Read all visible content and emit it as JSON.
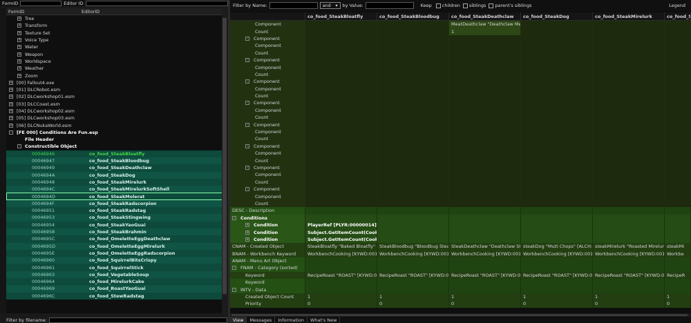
{
  "left": {
    "filter_formid_label": "FormID",
    "filter_editorid_label": "Editor ID",
    "col_formid": "FormID",
    "col_editorid": "EditorID",
    "tree_items": [
      {
        "icon": "+",
        "label": "Tree",
        "level": 2
      },
      {
        "icon": "+",
        "label": "Transform",
        "level": 2
      },
      {
        "icon": "+",
        "label": "Texture Set",
        "level": 2
      },
      {
        "icon": "+",
        "label": "Voice Type",
        "level": 2
      },
      {
        "icon": "+",
        "label": "Water",
        "level": 2
      },
      {
        "icon": "+",
        "label": "Weapon",
        "level": 2
      },
      {
        "icon": "+",
        "label": "Worldspace",
        "level": 2
      },
      {
        "icon": "+",
        "label": "Weather",
        "level": 2
      },
      {
        "icon": "+",
        "label": "Zoom",
        "level": 2
      },
      {
        "icon": "+",
        "label": "[00] Fallout4.exe",
        "level": 1
      },
      {
        "icon": "+",
        "label": "[01] DLCRobot.esm",
        "level": 1
      },
      {
        "icon": "+",
        "label": "[02] DLCworkshop01.esm",
        "level": 1
      },
      {
        "icon": "+",
        "label": "[03] DLCCoast.esm",
        "level": 1
      },
      {
        "icon": "+",
        "label": "[04] DLCworkshop02.esm",
        "level": 1
      },
      {
        "icon": "+",
        "label": "[05] DLCworkshop03.esm",
        "level": 1
      },
      {
        "icon": "+",
        "label": "[06] DLCNukaWorld.esm",
        "level": 1
      },
      {
        "icon": "-",
        "label": "[FE 000] Conditions Are Fun.esp",
        "level": 1,
        "bold": true
      },
      {
        "icon": "",
        "label": "File Header",
        "level": 2,
        "bold": true
      },
      {
        "icon": "-",
        "label": "Constructible Object",
        "level": 2,
        "bold": true
      }
    ],
    "records": [
      {
        "fid": "00046946",
        "eid": "co_food_SteakBloatfly",
        "selected": true
      },
      {
        "fid": "00046947",
        "eid": "co_food_SteakBloodbug"
      },
      {
        "fid": "00046949",
        "eid": "co_food_SteakDeathclaw"
      },
      {
        "fid": "0004694A",
        "eid": "co_food_SteakDog"
      },
      {
        "fid": "00046948",
        "eid": "co_food_SteakMirelurk"
      },
      {
        "fid": "0004694C",
        "eid": "co_food_SteakMirelurkSoftShell"
      },
      {
        "fid": "0004694D",
        "eid": "co_food_SteakMolerat",
        "outlined": true
      },
      {
        "fid": "0004694F",
        "eid": "co_food_SteakRadscorpion"
      },
      {
        "fid": "00046951",
        "eid": "co_food_SteakRadstag"
      },
      {
        "fid": "00046953",
        "eid": "co_food_SteakStingwing"
      },
      {
        "fid": "00046954",
        "eid": "co_food_SteakYaoGuai"
      },
      {
        "fid": "00046958",
        "eid": "co_food_SteakBrahmin"
      },
      {
        "fid": "0004695C",
        "eid": "co_food_OmeletteEggDeathclaw"
      },
      {
        "fid": "0004695D",
        "eid": "co_food_OmeletteEggMirelurk"
      },
      {
        "fid": "0004695E",
        "eid": "co_food_OmeletteEggRadscorpion"
      },
      {
        "fid": "00046960",
        "eid": "co_food_SquirrelBitsCrispy"
      },
      {
        "fid": "00046961",
        "eid": "co_food_SquirrelStick"
      },
      {
        "fid": "00046963",
        "eid": "co_food_VegetableSoup"
      },
      {
        "fid": "00046964",
        "eid": "co_food_MirelurkCake"
      },
      {
        "fid": "00046969",
        "eid": "co_food_RoastYaoGuai"
      },
      {
        "fid": "0004696C",
        "eid": "co_food_StewRadstag"
      }
    ],
    "filter_by_filename": "Filter by filename:"
  },
  "right": {
    "filter_by_name": "Filter by Name:",
    "and_option": "and",
    "by_value": "by Value:",
    "keep": "Keep",
    "children": "children",
    "siblings": "siblings",
    "parents_siblings": "parent's siblings",
    "legend": "Legend",
    "columns": [
      "",
      "co_food_SteakBloatfly",
      "co_food_SteakBloodbug",
      "co_food_SteakDeathclaw",
      "co_food_SteakDog",
      "co_food_SteakMirelurk",
      "co_food_Ste"
    ],
    "rows": [
      {
        "style": "olive",
        "indent": 2,
        "cells": [
          "Component",
          "",
          "",
          "MeatDeathclaw \"Deathclaw Mea...",
          "",
          "",
          ""
        ]
      },
      {
        "style": "olive",
        "indent": 2,
        "cells": [
          "Count",
          "",
          "",
          "1",
          "",
          "",
          ""
        ]
      },
      {
        "style": "olive",
        "indent": 1,
        "icon": "-",
        "cells": [
          "Component",
          "",
          "",
          "",
          "",
          "",
          ""
        ]
      },
      {
        "style": "olive",
        "indent": 2,
        "cells": [
          "Component",
          "",
          "",
          "",
          "",
          "",
          ""
        ]
      },
      {
        "style": "olive",
        "indent": 2,
        "cells": [
          "Count",
          "",
          "",
          "",
          "",
          "",
          ""
        ]
      },
      {
        "style": "olive",
        "indent": 1,
        "icon": "-",
        "cells": [
          "Component",
          "",
          "",
          "",
          "",
          "",
          ""
        ]
      },
      {
        "style": "olive",
        "indent": 2,
        "cells": [
          "Component",
          "",
          "",
          "",
          "",
          "",
          ""
        ]
      },
      {
        "style": "olive",
        "indent": 2,
        "cells": [
          "Count",
          "",
          "",
          "",
          "",
          "",
          ""
        ]
      },
      {
        "style": "olive",
        "indent": 1,
        "icon": "-",
        "cells": [
          "Component",
          "",
          "",
          "",
          "",
          "",
          ""
        ]
      },
      {
        "style": "olive",
        "indent": 2,
        "cells": [
          "Component",
          "",
          "",
          "",
          "",
          "",
          ""
        ]
      },
      {
        "style": "olive",
        "indent": 2,
        "cells": [
          "Count",
          "",
          "",
          "",
          "",
          "",
          ""
        ]
      },
      {
        "style": "olive",
        "indent": 1,
        "icon": "-",
        "cells": [
          "Component",
          "",
          "",
          "",
          "",
          "",
          ""
        ]
      },
      {
        "style": "olive",
        "indent": 2,
        "cells": [
          "Component",
          "",
          "",
          "",
          "",
          "",
          ""
        ]
      },
      {
        "style": "olive",
        "indent": 2,
        "cells": [
          "Count",
          "",
          "",
          "",
          "",
          "",
          ""
        ]
      },
      {
        "style": "olive",
        "indent": 1,
        "icon": "-",
        "cells": [
          "Component",
          "",
          "",
          "",
          "",
          "",
          ""
        ]
      },
      {
        "style": "olive",
        "indent": 2,
        "cells": [
          "Component",
          "",
          "",
          "",
          "",
          "",
          ""
        ]
      },
      {
        "style": "olive",
        "indent": 2,
        "cells": [
          "Count",
          "",
          "",
          "",
          "",
          "",
          ""
        ]
      },
      {
        "style": "olive",
        "indent": 1,
        "icon": "-",
        "cells": [
          "Component",
          "",
          "",
          "",
          "",
          "",
          ""
        ]
      },
      {
        "style": "olive",
        "indent": 2,
        "cells": [
          "Component",
          "",
          "",
          "",
          "",
          "",
          ""
        ]
      },
      {
        "style": "olive",
        "indent": 2,
        "cells": [
          "Count",
          "",
          "",
          "",
          "",
          "",
          ""
        ]
      },
      {
        "style": "olive",
        "indent": 1,
        "icon": "-",
        "cells": [
          "Component",
          "",
          "",
          "",
          "",
          "",
          ""
        ]
      },
      {
        "style": "olive",
        "indent": 2,
        "cells": [
          "Component",
          "",
          "",
          "",
          "",
          "",
          ""
        ]
      },
      {
        "style": "olive",
        "indent": 2,
        "cells": [
          "Count",
          "",
          "",
          "",
          "",
          "",
          ""
        ]
      },
      {
        "style": "olive",
        "indent": 1,
        "icon": "-",
        "cells": [
          "Component",
          "",
          "",
          "",
          "",
          "",
          ""
        ]
      },
      {
        "style": "olive",
        "indent": 2,
        "cells": [
          "Component",
          "",
          "",
          "",
          "",
          "",
          ""
        ]
      },
      {
        "style": "olive",
        "indent": 2,
        "cells": [
          "Count",
          "",
          "",
          "",
          "",
          "",
          ""
        ]
      },
      {
        "style": "green",
        "indent": 0,
        "cells": [
          "DESC - Description",
          "",
          "",
          "",
          "",
          "",
          ""
        ]
      },
      {
        "style": "bright",
        "indent": 0,
        "icon": "-",
        "bold": true,
        "cells": [
          "Conditions",
          "",
          "",
          "",
          "",
          "",
          ""
        ]
      },
      {
        "style": "bright",
        "indent": 1,
        "icon": "+",
        "bold": true,
        "cells": [
          "Condition",
          "PlayerRef [PLYR:00000014],Ha...",
          "",
          "",
          "",
          "",
          ""
        ]
      },
      {
        "style": "bright",
        "indent": 1,
        "icon": "+",
        "bold": true,
        "cells": [
          "Condition",
          "Subject.GetItemCount(Cookin...",
          "",
          "",
          "",
          "",
          ""
        ]
      },
      {
        "style": "bright",
        "indent": 1,
        "icon": "+",
        "bold": true,
        "cells": [
          "Condition",
          "Subject.GetItemCount(Cookin...",
          "",
          "",
          "",
          "",
          ""
        ]
      },
      {
        "style": "cnam",
        "indent": 0,
        "cells": [
          "CNAM - Created Object",
          "SteakBloatfly \"Baked Bloatfly\" [A...",
          "SteakBloodbug \"Bloodbug Steak...",
          "SteakDeathclaw \"Deathclaw Stea...",
          "steakDog \"Mutt Chops\" [ALCH:0...",
          "steakMirelurk \"Roasted Mirelurk ...",
          "steakMi"
        ]
      },
      {
        "style": "cnam",
        "indent": 0,
        "cells": [
          "BNAM - Workbench Keyword",
          "WorkbenchCooking [KYWD:0010...",
          "WorkbenchCooking [KYWD:0010...",
          "WorkbenchCooking [KYWD:0010...",
          "WorkbenchCooking [KYWD:0010...",
          "WorkbenchCooking [KYWD:0010...",
          "Workbe"
        ]
      },
      {
        "style": "green",
        "indent": 0,
        "cells": [
          "ANAM - Menu Art Object",
          "",
          "",
          "",
          "",
          "",
          ""
        ]
      },
      {
        "style": "green",
        "indent": 0,
        "icon": "-",
        "cells": [
          "FNAM - Category (sorted)",
          "",
          "",
          "",
          "",
          "",
          ""
        ]
      },
      {
        "style": "cnam",
        "indent": 1,
        "cells": [
          "Keyword",
          "RecipeRoast \"ROAST\" [KYWD:00...",
          "RecipeRoast \"ROAST\" [KYWD:00...",
          "RecipeRoast \"ROAST\" [KYWD:00...",
          "RecipeRoast \"ROAST\" [KYWD:00...",
          "RecipeRoast \"ROAST\" [KYWD:00...",
          "RecipeR"
        ]
      },
      {
        "style": "green",
        "indent": 1,
        "cells": [
          "Keyword",
          "",
          "",
          "",
          "",
          "",
          ""
        ]
      },
      {
        "style": "green",
        "indent": 0,
        "icon": "-",
        "cells": [
          "INTV - Data",
          "",
          "",
          "",
          "",
          "",
          ""
        ]
      },
      {
        "style": "cnam",
        "indent": 1,
        "cells": [
          "Created Object Count",
          "1",
          "1",
          "1",
          "1",
          "1",
          "1"
        ]
      },
      {
        "style": "cnam",
        "indent": 1,
        "cells": [
          "Priority",
          "0",
          "0",
          "0",
          "0",
          "0",
          "0"
        ]
      }
    ],
    "tabs": [
      {
        "label": "View",
        "active": true
      },
      {
        "label": "Messages"
      },
      {
        "label": "Information"
      },
      {
        "label": "What's New"
      }
    ]
  }
}
